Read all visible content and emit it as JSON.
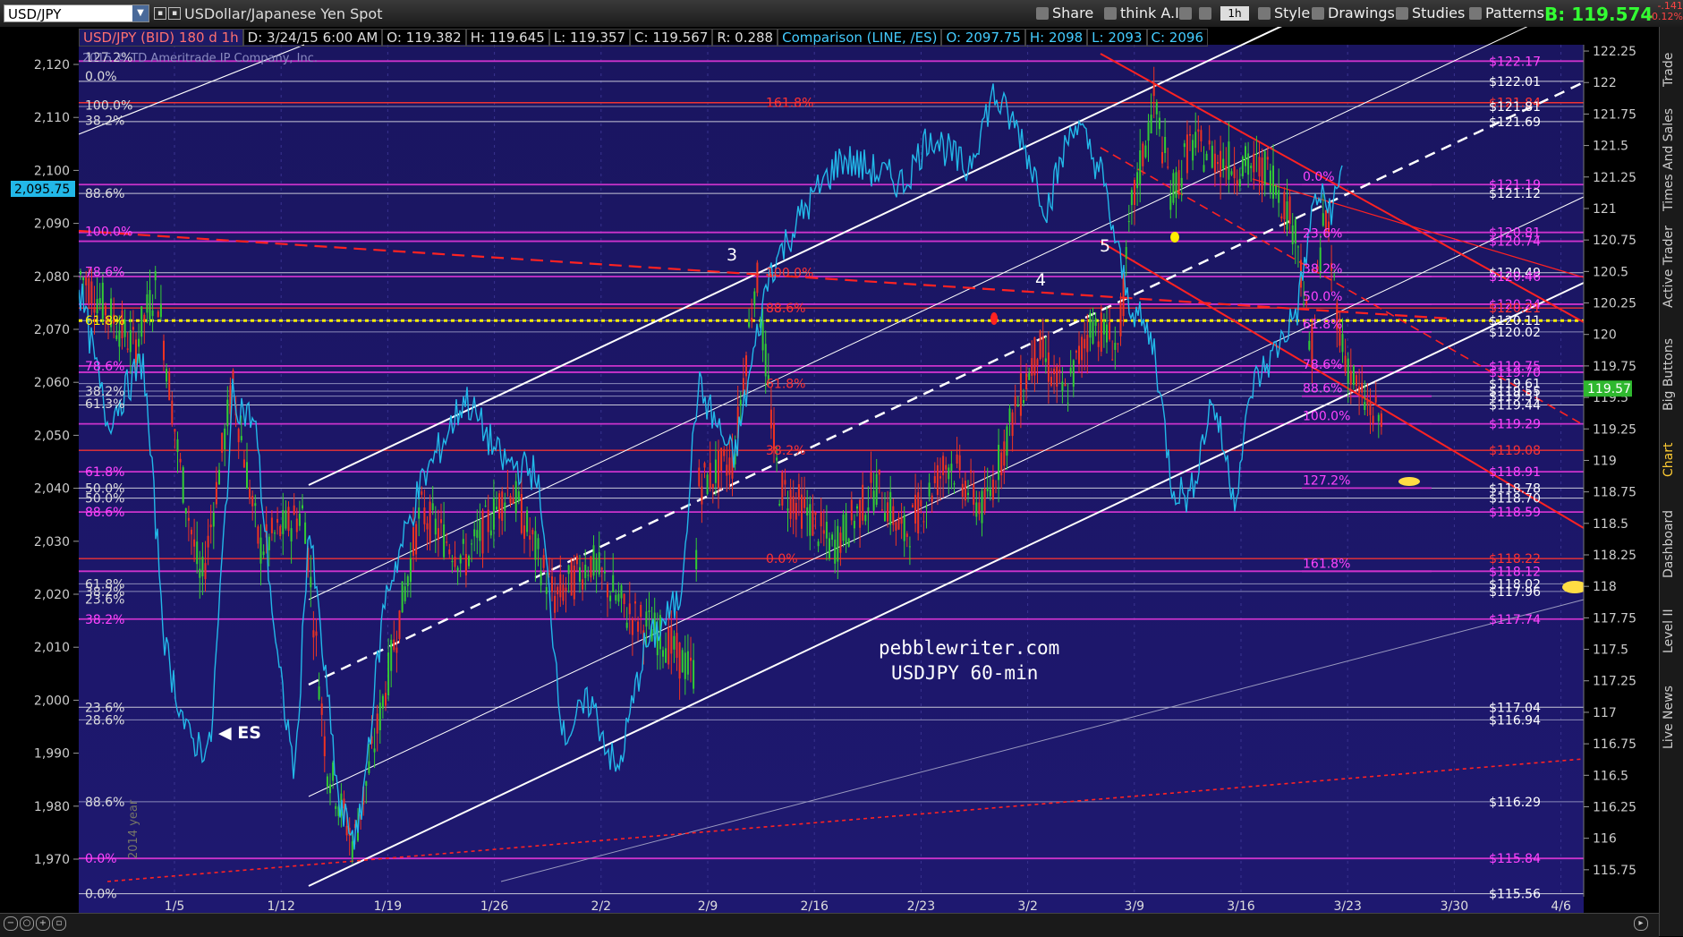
{
  "toolbar": {
    "symbol": "USD/JPY",
    "security_name": "USDollar/Japanese Yen Spot",
    "share": "Share",
    "think_ai": "think A.I.",
    "timeframe": "1h",
    "style": "Style",
    "drawings": "Drawings",
    "studies": "Studies",
    "patterns": "Patterns",
    "bid_label": "B:",
    "bid_value": "119.574",
    "change_1": "-.141",
    "change_2": "-0.12%"
  },
  "header_row": {
    "title": "USD/JPY (BID) 180 d 1h",
    "d": "D: 3/24/15 6:00 AM",
    "o": "O: 119.382",
    "h": "H: 119.645",
    "l": "L: 119.357",
    "c": "C: 119.567",
    "r": "R: 0.288",
    "comparison": "Comparison (LINE, /ES)",
    "co": "O: 2097.75",
    "ch": "H: 2098",
    "cl": "L: 2093",
    "cc": "C: 2096"
  },
  "copyright": "2015 © TD Ameritrade IP Company, Inc.",
  "watermark": {
    "line1": "pebblewriter.com",
    "line2": "USDJPY 60-min"
  },
  "es_label": "ES",
  "year_label": "2014 year",
  "wave_labels": [
    "3",
    "4",
    "5"
  ],
  "sidebar": {
    "tabs": [
      "Trade",
      "Times And Sales",
      "Active Trader",
      "Big Buttons",
      "Chart",
      "Dashboard",
      "Level II",
      "Live News"
    ],
    "active": "Chart"
  },
  "colors": {
    "background": "#1c1565",
    "price_line": "#22b8e8",
    "bull_candle": "#33cc33",
    "bear_candle": "#ee3322",
    "fib_magenta": "#cc33cc",
    "channel": "#ffffff",
    "red_channel": "#ff2222",
    "yellow_dotted": "#ffee00"
  },
  "chart_data": {
    "type": "line",
    "title": "USD/JPY (BID) 180 d 1h",
    "right_axis": {
      "label": "USD/JPY",
      "ylim": [
        115.55,
        122.3
      ],
      "ticks": [
        "122.25",
        "122",
        "121.75",
        "121.5",
        "121.25",
        "121",
        "120.75",
        "120.5",
        "120.25",
        "120",
        "119.75",
        "119.5",
        "119.25",
        "119",
        "118.75",
        "118.5",
        "118.25",
        "118",
        "117.75",
        "117.5",
        "117.25",
        "117",
        "116.75",
        "116.5",
        "116.25",
        "116",
        "115.75"
      ],
      "current_price": "119.57"
    },
    "left_axis": {
      "label": "/ES",
      "ticks": [
        "2,120",
        "2,110",
        "2,100",
        "2,090",
        "2,080",
        "2,070",
        "2,060",
        "2,050",
        "2,040",
        "2,030",
        "2,020",
        "2,010",
        "2,000",
        "1,990",
        "1,980",
        "1,970"
      ],
      "current_value": "2,095.75"
    },
    "x_ticks": [
      "1/5",
      "1/12",
      "1/19",
      "1/26",
      "2/2",
      "2/9",
      "2/16",
      "2/23",
      "3/2",
      "3/9",
      "3/16",
      "3/23",
      "3/30",
      "4/6"
    ],
    "price_levels_right": [
      {
        "label": "$122.17",
        "value": 122.17
      },
      {
        "label": "$122.01",
        "value": 122.01
      },
      {
        "label": "$121.84",
        "value": 121.84
      },
      {
        "label": "$121.81",
        "value": 121.81
      },
      {
        "label": "$121.69",
        "value": 121.69
      },
      {
        "label": "$121.19",
        "value": 121.19
      },
      {
        "label": "$121.12",
        "value": 121.12
      },
      {
        "label": "$120.81",
        "value": 120.81
      },
      {
        "label": "$120.74",
        "value": 120.74
      },
      {
        "label": "$120.49",
        "value": 120.49
      },
      {
        "label": "$120.46",
        "value": 120.46
      },
      {
        "label": "$120.24",
        "value": 120.24
      },
      {
        "label": "$120.21",
        "value": 120.21
      },
      {
        "label": "$120.11",
        "value": 120.11
      },
      {
        "label": "$120.02",
        "value": 120.02
      },
      {
        "label": "$119.75",
        "value": 119.75
      },
      {
        "label": "$119.70",
        "value": 119.7
      },
      {
        "label": "$119.61",
        "value": 119.61
      },
      {
        "label": "$119.55",
        "value": 119.55
      },
      {
        "label": "$119.51",
        "value": 119.51
      },
      {
        "label": "$119.44",
        "value": 119.44
      },
      {
        "label": "$119.29",
        "value": 119.29
      },
      {
        "label": "$119.08",
        "value": 119.08
      },
      {
        "label": "$118.91",
        "value": 118.91
      },
      {
        "label": "$118.78",
        "value": 118.78
      },
      {
        "label": "$118.70",
        "value": 118.7
      },
      {
        "label": "$118.59",
        "value": 118.59
      },
      {
        "label": "$118.22",
        "value": 118.22
      },
      {
        "label": "$118.12",
        "value": 118.12
      },
      {
        "label": "$118.02",
        "value": 118.02
      },
      {
        "label": "$117.96",
        "value": 117.96
      },
      {
        "label": "$117.74",
        "value": 117.74
      },
      {
        "label": "$117.04",
        "value": 117.04
      },
      {
        "label": "$116.94",
        "value": 116.94
      },
      {
        "label": "$116.29",
        "value": 116.29
      },
      {
        "label": "$115.84",
        "value": 115.84
      },
      {
        "label": "$115.56",
        "value": 115.56
      }
    ],
    "fib_labels_left": [
      {
        "label": "127.2%",
        "value": 122.2
      },
      {
        "label": "0.0%",
        "value": 122.05
      },
      {
        "label": "100.0%",
        "value": 121.82
      },
      {
        "label": "38.2%",
        "value": 121.7
      },
      {
        "label": "88.6%",
        "value": 121.12
      },
      {
        "label": "100.0%",
        "value": 120.82
      },
      {
        "label": "78.6%",
        "value": 120.5
      },
      {
        "label": "61.8%",
        "value": 120.11
      },
      {
        "label": "78.6%",
        "value": 119.75
      },
      {
        "label": "38.2%",
        "value": 119.55
      },
      {
        "label": "61.3%",
        "value": 119.45
      },
      {
        "label": "61.8%",
        "value": 118.91
      },
      {
        "label": "50.0%",
        "value": 118.78
      },
      {
        "label": "50.0%",
        "value": 118.7
      },
      {
        "label": "88.6%",
        "value": 118.59
      },
      {
        "label": "61.8%",
        "value": 118.02
      },
      {
        "label": "38.2%",
        "value": 117.96
      },
      {
        "label": "23.6%",
        "value": 117.9
      },
      {
        "label": "38.2%",
        "value": 117.74
      },
      {
        "label": "23.6%",
        "value": 117.04
      },
      {
        "label": "28.6%",
        "value": 116.94
      },
      {
        "label": "88.6%",
        "value": 116.29
      },
      {
        "label": "0.0%",
        "value": 115.84
      },
      {
        "label": "0.0%",
        "value": 115.56
      }
    ],
    "fib_labels_mid": [
      {
        "label": "161.8%",
        "value": 121.84
      },
      {
        "label": "100.0%",
        "value": 120.49
      },
      {
        "label": "88.6%",
        "value": 120.21
      },
      {
        "label": "61.8%",
        "value": 119.61
      },
      {
        "label": "38.2%",
        "value": 119.08
      },
      {
        "label": "0.0%",
        "value": 118.22
      }
    ],
    "fib_labels_right": [
      {
        "label": "0.0%",
        "value": 121.19
      },
      {
        "label": "23.6%",
        "value": 120.74
      },
      {
        "label": "38.2%",
        "value": 120.46
      },
      {
        "label": "50.0%",
        "value": 120.24
      },
      {
        "label": "61.8%",
        "value": 120.02
      },
      {
        "label": "78.6%",
        "value": 119.7
      },
      {
        "label": "88.6%",
        "value": 119.51
      },
      {
        "label": "100.0%",
        "value": 119.29
      },
      {
        "label": "127.2%",
        "value": 118.78
      },
      {
        "label": "161.8%",
        "value": 118.12
      }
    ]
  }
}
